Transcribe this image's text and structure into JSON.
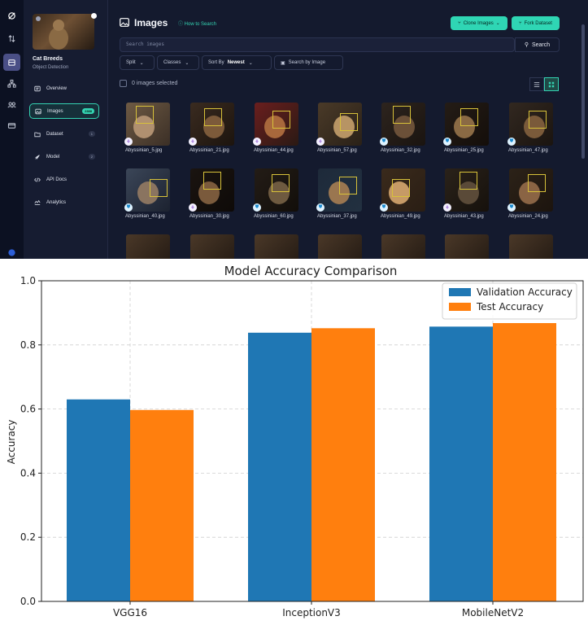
{
  "app": {
    "project_name": "Cat Breeds",
    "project_type": "Object Detection",
    "nav": [
      {
        "label": "Overview",
        "icon": "image-icon"
      },
      {
        "label": "Images",
        "icon": "images-icon",
        "count": "2388"
      },
      {
        "label": "Dataset",
        "icon": "folder-icon",
        "count": "1"
      },
      {
        "label": "Model",
        "icon": "rocket-icon",
        "count": "2"
      },
      {
        "label": "API Docs",
        "icon": "code-icon"
      },
      {
        "label": "Analytics",
        "icon": "analytics-icon"
      }
    ],
    "page_title": "Images",
    "how_to_search": "How to Search",
    "clone_images": "Clone Images",
    "fork_dataset": "Fork Dataset",
    "search_placeholder": "Search images",
    "search_button": "Search",
    "filters": {
      "split": "Split",
      "classes": "Classes",
      "sort_by": "Sort By",
      "sort_value": "Newest",
      "search_by_image": "Search by Image"
    },
    "selected_text": "0 images selected",
    "images": [
      {
        "name": "Abyssinian_5.jpg",
        "badge": "purple"
      },
      {
        "name": "Abyssinian_21.jpg",
        "badge": "purple"
      },
      {
        "name": "Abyssinian_44.jpg",
        "badge": "purple"
      },
      {
        "name": "Abyssinian_57.jpg",
        "badge": "purple"
      },
      {
        "name": "Abyssinian_32.jpg",
        "badge": "blue"
      },
      {
        "name": "Abyssinian_25.jpg",
        "badge": "blue"
      },
      {
        "name": "Abyssinian_47.jpg",
        "badge": "blue"
      },
      {
        "name": "Abyssinian_40.jpg",
        "badge": "blue"
      },
      {
        "name": "Abyssinian_30.jpg",
        "badge": "purple"
      },
      {
        "name": "Abyssinian_60.jpg",
        "badge": "blue"
      },
      {
        "name": "Abyssinian_37.jpg",
        "badge": "blue"
      },
      {
        "name": "Abyssinian_49.jpg",
        "badge": "blue"
      },
      {
        "name": "Abyssinian_43.jpg",
        "badge": "purple"
      },
      {
        "name": "Abyssinian_24.jpg",
        "badge": "blue"
      }
    ],
    "colors": {
      "accent": "#2fd6b4",
      "bg": "#141a2e"
    }
  },
  "chart_data": {
    "type": "bar",
    "title": "Model Accuracy Comparison",
    "xlabel": "",
    "ylabel": "Accuracy",
    "categories": [
      "VGG16",
      "InceptionV3",
      "MobileNetV2"
    ],
    "series": [
      {
        "name": "Validation Accuracy",
        "color": "#1f77b4",
        "values": [
          0.63,
          0.838,
          0.857
        ]
      },
      {
        "name": "Test Accuracy",
        "color": "#ff7f0e",
        "values": [
          0.597,
          0.852,
          0.868
        ]
      }
    ],
    "ylim": [
      0,
      1.0
    ],
    "yticks": [
      "0.0",
      "0.2",
      "0.4",
      "0.6",
      "0.8",
      "1.0"
    ],
    "grid": true,
    "legend": "top-right"
  }
}
